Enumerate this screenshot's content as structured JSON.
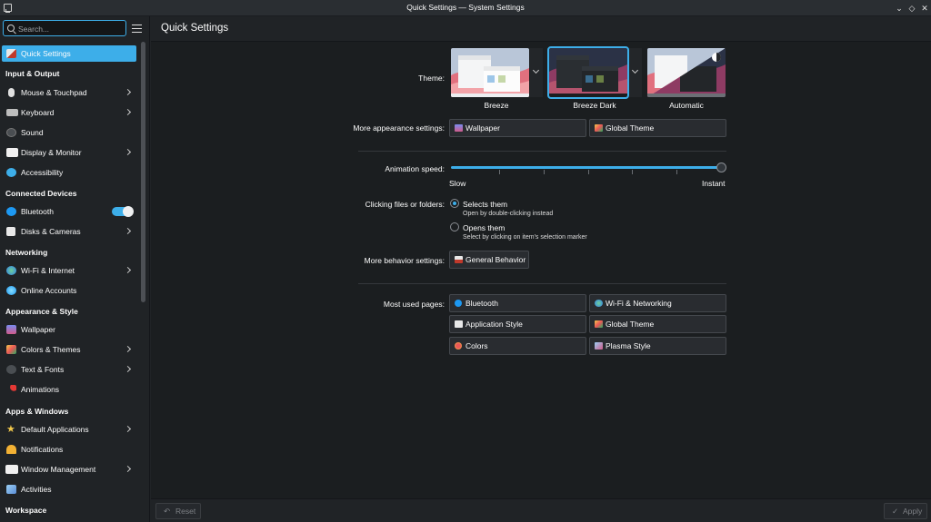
{
  "window": {
    "title": "Quick Settings — System Settings"
  },
  "sidebar": {
    "search_placeholder": "Search...",
    "sections": {
      "input_output": "Input & Output",
      "connected_devices": "Connected Devices",
      "networking": "Networking",
      "appearance_style": "Appearance & Style",
      "apps_windows": "Apps & Windows",
      "workspace": "Workspace"
    },
    "items": {
      "quick_settings": "Quick Settings",
      "mouse_touchpad": "Mouse & Touchpad",
      "keyboard": "Keyboard",
      "sound": "Sound",
      "display_monitor": "Display & Monitor",
      "accessibility": "Accessibility",
      "bluetooth": "Bluetooth",
      "disks_cameras": "Disks & Cameras",
      "wifi_internet": "Wi-Fi & Internet",
      "online_accounts": "Online Accounts",
      "wallpaper": "Wallpaper",
      "colors_themes": "Colors & Themes",
      "text_fonts": "Text & Fonts",
      "animations": "Animations",
      "default_applications": "Default Applications",
      "notifications": "Notifications",
      "window_management": "Window Management",
      "activities": "Activities"
    },
    "bluetooth_enabled": true
  },
  "header": {
    "title": "Quick Settings"
  },
  "main": {
    "theme": {
      "label": "Theme:",
      "options": [
        "Breeze",
        "Breeze Dark",
        "Automatic"
      ],
      "selected": "Breeze Dark"
    },
    "appearance": {
      "label": "More appearance settings:",
      "wallpaper": "Wallpaper",
      "global_theme": "Global Theme"
    },
    "animation": {
      "label": "Animation speed:",
      "min_label": "Slow",
      "max_label": "Instant",
      "value": 1.0
    },
    "clicking": {
      "label": "Clicking files or folders:",
      "opt1": "Selects them",
      "opt1_sub": "Open by double-clicking instead",
      "opt2": "Opens them",
      "opt2_sub": "Select by clicking on item's selection marker",
      "selected": "Selects them"
    },
    "behavior": {
      "label": "More behavior settings:",
      "general": "General Behavior"
    },
    "most_used": {
      "label": "Most used pages:",
      "bluetooth": "Bluetooth",
      "wifi_networking": "Wi-Fi & Networking",
      "application_style": "Application Style",
      "global_theme": "Global Theme",
      "colors": "Colors",
      "plasma_style": "Plasma Style"
    }
  },
  "footer": {
    "reset": "Reset",
    "apply": "Apply"
  },
  "colors": {
    "accent": "#3daee9",
    "background": "#1b1e20",
    "sidebar": "#202326"
  }
}
